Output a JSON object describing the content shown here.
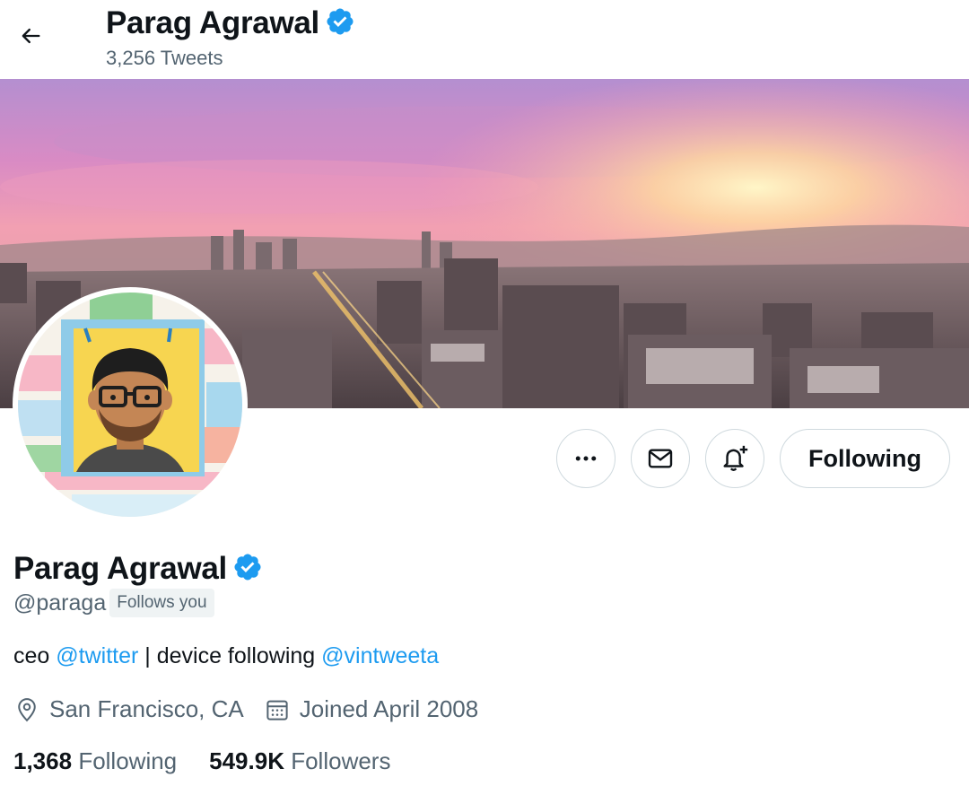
{
  "header": {
    "name": "Parag Agrawal",
    "tweet_count": "3,256 Tweets"
  },
  "actions": {
    "following_label": "Following"
  },
  "profile": {
    "name": "Parag Agrawal",
    "handle": "@paraga",
    "follows_you": "Follows you",
    "bio": {
      "prefix": "ceo ",
      "mention1": "@twitter",
      "middle": " | device following ",
      "mention2": "@vintweeta"
    },
    "location": "San Francisco, CA",
    "joined": "Joined April 2008",
    "following_count": "1,368",
    "following_label": "Following",
    "followers_count": "549.9K",
    "followers_label": "Followers"
  },
  "icons": {
    "back": "arrow-left-icon",
    "verified": "verified-badge-icon",
    "more": "more-horizontal-icon",
    "message": "envelope-icon",
    "notify": "bell-plus-icon",
    "location": "map-pin-icon",
    "calendar": "calendar-icon"
  },
  "colors": {
    "accent": "#1d9bf0",
    "text": "#0f1419",
    "secondary": "#536471",
    "border": "#cfd9de"
  }
}
